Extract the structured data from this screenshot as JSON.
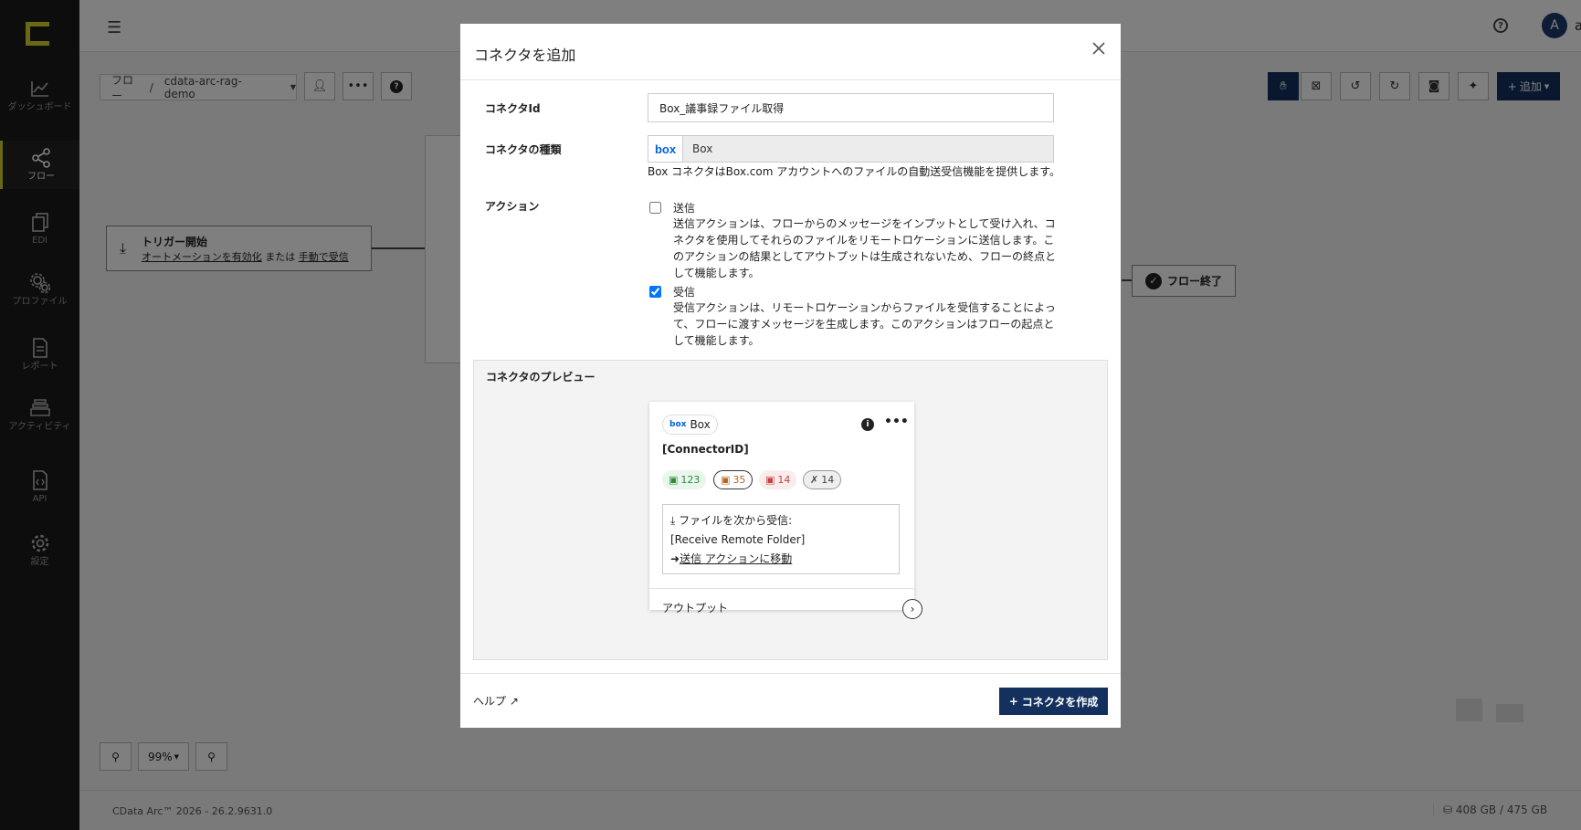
{
  "sidebar": {
    "items": [
      {
        "label": "ダッシュボード"
      },
      {
        "label": "フロー"
      },
      {
        "label": "EDI"
      },
      {
        "label": "プロファイル"
      },
      {
        "label": "レポート"
      },
      {
        "label": "アクティビティ"
      },
      {
        "label": "API"
      },
      {
        "label": "設定"
      }
    ],
    "accent_color": "#d7d229"
  },
  "header": {
    "user_initial": "A",
    "username": "admin"
  },
  "toolbar": {
    "breadcrumb_root": "フロー",
    "breadcrumb_sep": "/",
    "flow_name": "cdata-arc-rag-demo",
    "add_label": "追加"
  },
  "canvas": {
    "trigger_title": "トリガー開始",
    "trigger_link1": "オートメーションを有効化",
    "trigger_or": "または",
    "trigger_link2": "手動で受信",
    "end_label": "フロー終了",
    "zoom_level": "99%"
  },
  "footer": {
    "version": "CData Arc™ 2026 - 26.2.9631.0",
    "storage": "408 GB / 475 GB"
  },
  "modal": {
    "title": "コネクタを追加",
    "connector_id_label": "コネクタId",
    "connector_id_value": "Box_議事録ファイル取得",
    "connector_type_label": "コネクタの種類",
    "connector_type_logo": "box",
    "connector_type_value": "Box",
    "connector_type_desc": "Box コネクタはBox.com アカウントへのファイルの自動送受信機能を提供します。",
    "action_label": "アクション",
    "actions": [
      {
        "title": "送信",
        "checked": false,
        "desc": "送信アクションは、フローからのメッセージをインプットとして受け入れ、コネクタを使用してそれらのファイルをリモートロケーションに送信します。このアクションの結果としてアウトプットは生成されないため、フローの終点として機能します。"
      },
      {
        "title": "受信",
        "checked": true,
        "desc": "受信アクションは、リモートロケーションからファイルを受信することによって、フローに渡すメッセージを生成します。このアクションはフローの起点として機能します。"
      }
    ],
    "preview": {
      "section_title": "コネクタのプレビュー",
      "tag_logo": "box",
      "tag_label": "Box",
      "connector_id": "[ConnectorID]",
      "badges": {
        "green": "123",
        "orange": "35",
        "red": "14",
        "gray": "14"
      },
      "receive_label": "ファイルを次から受信:",
      "receive_folder": "[Receive Remote Folder]",
      "goto_send": "送信 アクションに移動",
      "output_label": "アウトプット"
    },
    "help_label": "ヘルプ",
    "create_label": "コネクタを作成",
    "primary_color": "#13305e"
  }
}
